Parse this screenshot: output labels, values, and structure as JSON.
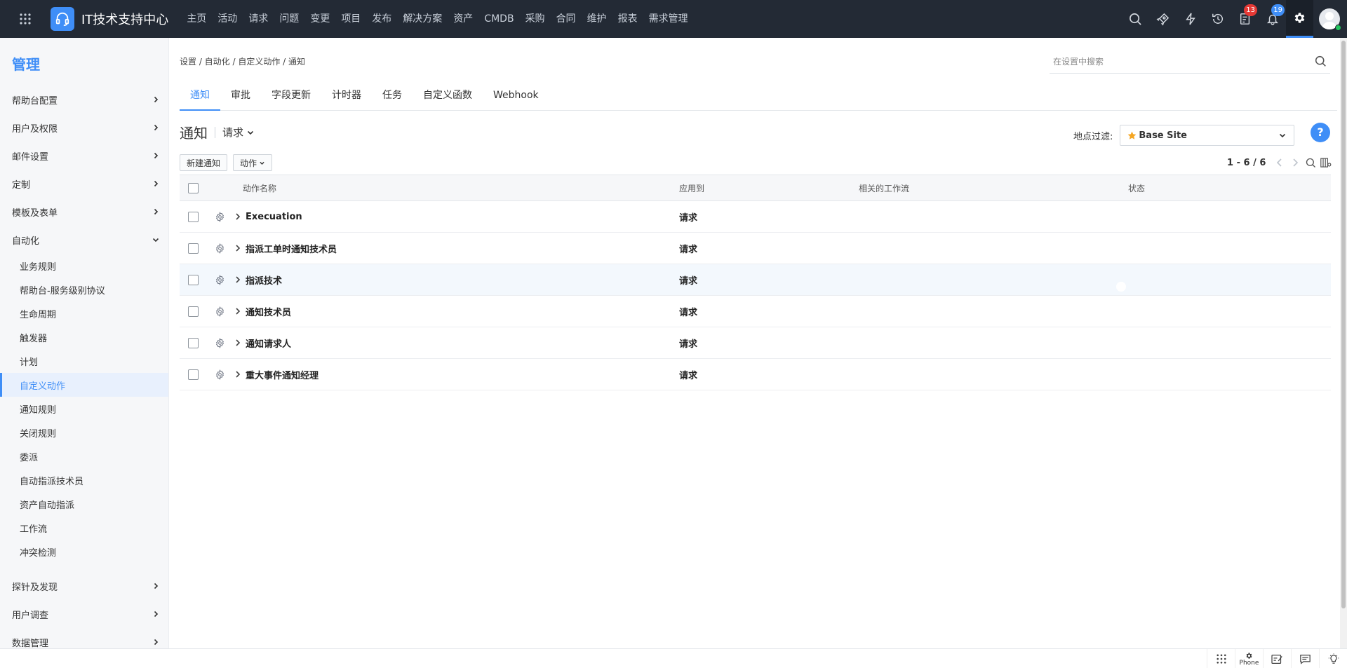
{
  "app": {
    "title": "IT技术支持中心"
  },
  "nav": [
    "主页",
    "活动",
    "请求",
    "问题",
    "变更",
    "项目",
    "发布",
    "解决方案",
    "资产",
    "CMDB",
    "采购",
    "合同",
    "维护",
    "报表",
    "需求管理"
  ],
  "topbar": {
    "icons": [
      "search-icon",
      "rocket-icon",
      "lightning-icon",
      "history-icon",
      "tasks-icon",
      "bell-icon",
      "gear-icon"
    ],
    "tasks_badge": "13",
    "notifications_badge": "19"
  },
  "sidebar": {
    "title": "管理",
    "top_groups": [
      "帮助台配置",
      "用户及权限",
      "邮件设置",
      "定制",
      "模板及表单"
    ],
    "automation": {
      "label": "自动化",
      "items": [
        "业务规则",
        "帮助台-服务级别协议",
        "生命周期",
        "触发器",
        "计划",
        "自定义动作",
        "通知规则",
        "关闭规则",
        "委派",
        "自动指派技术员",
        "资产自动指派",
        "工作流",
        "冲突检测"
      ],
      "active": "自定义动作"
    },
    "bottom_groups": [
      "探针及发现",
      "用户调查",
      "数据管理"
    ]
  },
  "breadcrumb": "设置 / 自动化 / 自定义动作 / 通知",
  "search": {
    "placeholder": "在设置中搜索"
  },
  "tabs": [
    "通知",
    "审批",
    "字段更新",
    "计时器",
    "任务",
    "自定义函数",
    "Webhook"
  ],
  "page": {
    "title": "通知",
    "module": "请求",
    "site_filter_label": "地点过滤:",
    "site": "Base Site",
    "help": "?"
  },
  "toolbar": {
    "new_button": "新建通知",
    "actions_button": "动作"
  },
  "pager": {
    "range": "1 - 6 / 6"
  },
  "table": {
    "headers": {
      "name": "动作名称",
      "apply_to": "应用到",
      "workflow": "相关的工作流",
      "status": "状态"
    },
    "rows": [
      {
        "name": "Execuation",
        "apply_to": "请求",
        "workflow": "",
        "enabled": true
      },
      {
        "name": "指派工单时通知技术员",
        "apply_to": "请求",
        "workflow": "",
        "enabled": true
      },
      {
        "name": "指派技术",
        "apply_to": "请求",
        "workflow": "",
        "enabled": true
      },
      {
        "name": "通知技术员",
        "apply_to": "请求",
        "workflow": "",
        "enabled": true
      },
      {
        "name": "通知请求人",
        "apply_to": "请求",
        "workflow": "",
        "enabled": true
      },
      {
        "name": "重大事件通知经理",
        "apply_to": "请求",
        "workflow": "",
        "enabled": true
      }
    ]
  },
  "footer": {
    "phone_label": "Phone"
  },
  "colors": {
    "accent": "#3f8ef7",
    "topbar": "#232a35",
    "toggle_on": "#16b14b",
    "badge_red": "#e53935"
  }
}
